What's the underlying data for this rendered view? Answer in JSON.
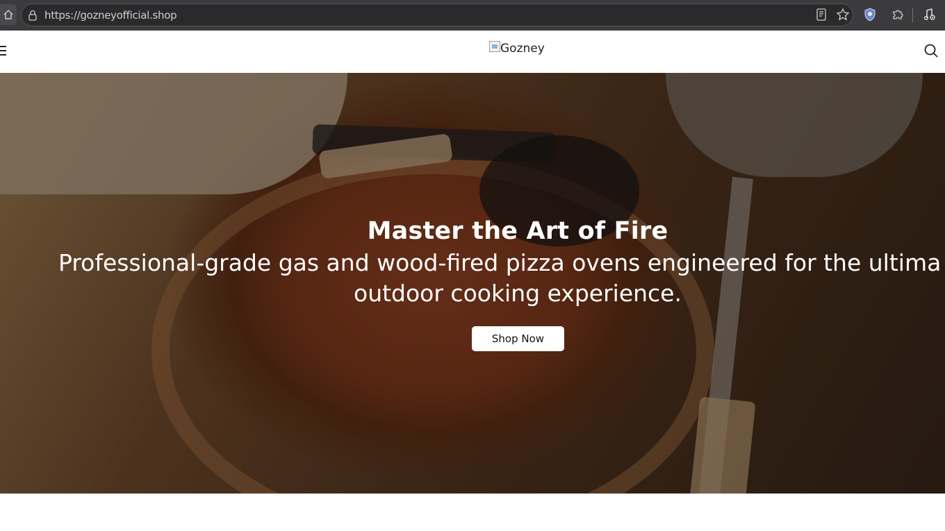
{
  "browser": {
    "url": "https://gozneyofficial.shop",
    "icons": [
      "home-icon",
      "lock-icon",
      "reader-mode-icon",
      "bookmark-star-icon",
      "shield-extension-icon",
      "extensions-puzzle-icon",
      "media-control-icon"
    ]
  },
  "header": {
    "logo_alt": "Gozney",
    "menu_icon": "hamburger-menu-icon",
    "search_icon": "search-icon"
  },
  "hero": {
    "title": "Master the Art of Fire",
    "subtitle_line1": "Professional-grade gas and wood-fired pizza ovens engineered for the ultima",
    "subtitle_line2": "outdoor cooking experience.",
    "cta_label": "Shop Now"
  },
  "colors": {
    "browser_bar": "#3b3b3d",
    "url_pill": "#2a2a2c",
    "hero_text": "#ffffff",
    "cta_bg": "#ffffff"
  }
}
